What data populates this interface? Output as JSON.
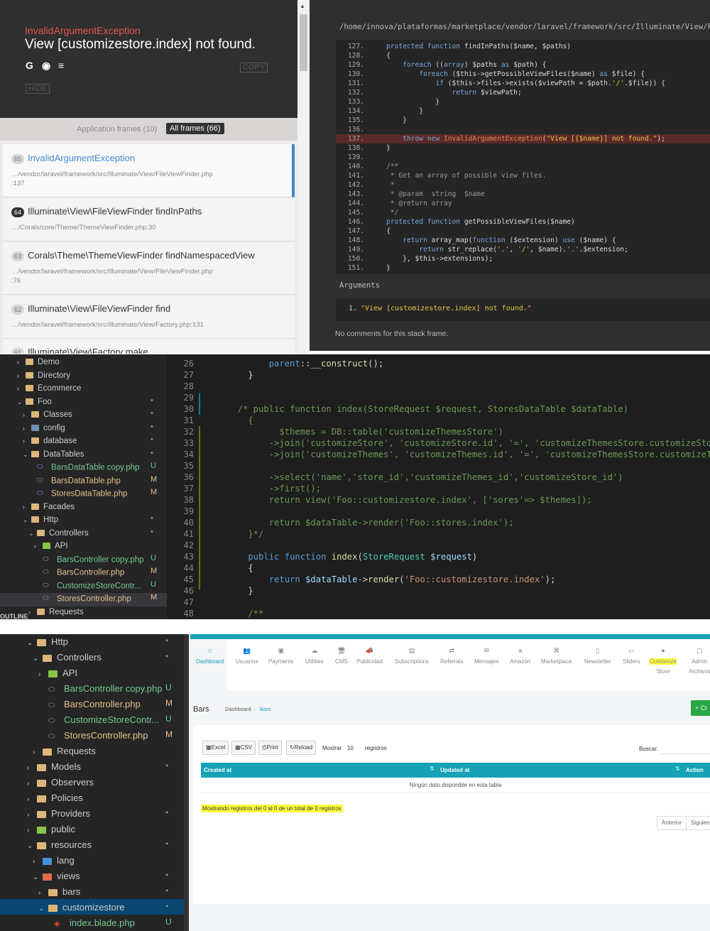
{
  "whoops": {
    "exception_class": "InvalidArgumentException",
    "exception_message": "View [customizestore.index] not found.",
    "copy_label": "COPY",
    "hide_label": "HIDE",
    "tabs": {
      "app": "Application frames (10)",
      "all": "All frames (66)"
    },
    "frames": [
      {
        "num": "65",
        "title": "InvalidArgumentException",
        "file": "…/vendor/laravel/framework/src/Illuminate/View/FileViewFinder.php",
        "line": ":137"
      },
      {
        "num": "64",
        "title": "Illuminate\\View\\FileViewFinder findInPaths",
        "file": "…/Corals/core/Theme/ThemeViewFinder.php:30",
        "line": ""
      },
      {
        "num": "63",
        "title": "Corals\\Theme\\ThemeViewFinder findNamespacedView",
        "file": "…/vendor/laravel/framework/src/Illuminate/View/FileViewFinder.php",
        "line": ":76"
      },
      {
        "num": "62",
        "title": "Illuminate\\View\\FileViewFinder find",
        "file": "…/vendor/laravel/framework/src/Illuminate/View/Factory.php:131",
        "line": ""
      },
      {
        "num": "61",
        "title": "Illuminate\\View\\Factory make",
        "file": "",
        "line": ""
      }
    ],
    "file_path": "/home/innova/plataformas/marketplace/vendor/laravel/framework/src/Illuminate/View/FileViewFinder.php",
    "arguments_title": "Arguments",
    "argument_num": "1.",
    "argument_1": "\"View [customizestore.index] not found.\"",
    "no_comments": "No comments for this stack frame.",
    "code": [
      {
        "n": "127.",
        "t": "    protected function findInPaths($name, $paths)"
      },
      {
        "n": "128.",
        "t": "    {"
      },
      {
        "n": "129.",
        "t": "        foreach ((array) $paths as $path) {"
      },
      {
        "n": "130.",
        "t": "            foreach ($this->getPossibleViewFiles($name) as $file) {"
      },
      {
        "n": "131.",
        "t": "                if ($this->files->exists($viewPath = $path.'/'.$file)) {"
      },
      {
        "n": "132.",
        "t": "                    return $viewPath;"
      },
      {
        "n": "133.",
        "t": "                }"
      },
      {
        "n": "134.",
        "t": "            }"
      },
      {
        "n": "135.",
        "t": "        }"
      },
      {
        "n": "136.",
        "t": ""
      },
      {
        "n": "137.",
        "t": "        throw new InvalidArgumentException(\"View [{$name}] not found.\");"
      },
      {
        "n": "138.",
        "t": "    }"
      },
      {
        "n": "139.",
        "t": ""
      },
      {
        "n": "140.",
        "t": "    /**"
      },
      {
        "n": "141.",
        "t": "     * Get an array of possible view files."
      },
      {
        "n": "142.",
        "t": "     *"
      },
      {
        "n": "143.",
        "t": "     * @param  string  $name"
      },
      {
        "n": "144.",
        "t": "     * @return array"
      },
      {
        "n": "145.",
        "t": "     */"
      },
      {
        "n": "146.",
        "t": "    protected function getPossibleViewFiles($name)"
      },
      {
        "n": "147.",
        "t": "    {"
      },
      {
        "n": "148.",
        "t": "        return array_map(function ($extension) use ($name) {"
      },
      {
        "n": "149.",
        "t": "            return str_replace('.', '/', $name).'.'.$extension;"
      },
      {
        "n": "150.",
        "t": "        }, $this->extensions);"
      },
      {
        "n": "151.",
        "t": "    }"
      }
    ]
  },
  "editor": {
    "tree": [
      {
        "label": "Demo",
        "indent": 0,
        "open": false,
        "kind": "folder",
        "badge": ""
      },
      {
        "label": "Directory",
        "indent": 0,
        "open": false,
        "kind": "folder",
        "badge": ""
      },
      {
        "label": "Ecommerce",
        "indent": 0,
        "open": false,
        "kind": "folder",
        "badge": ""
      },
      {
        "label": "Foo",
        "indent": 0,
        "open": true,
        "kind": "folder",
        "badge": "•"
      },
      {
        "label": "Classes",
        "indent": 1,
        "open": false,
        "kind": "folder",
        "badge": "•"
      },
      {
        "label": "config",
        "indent": 1,
        "open": false,
        "kind": "cfg",
        "badge": "•"
      },
      {
        "label": "database",
        "indent": 1,
        "open": false,
        "kind": "folder",
        "badge": "•"
      },
      {
        "label": "DataTables",
        "indent": 1,
        "open": true,
        "kind": "folder",
        "badge": "•"
      },
      {
        "label": "BarsDataTable copy.php",
        "indent": 2,
        "open": null,
        "kind": "php-u",
        "badge": "U"
      },
      {
        "label": "BarsDataTable.php",
        "indent": 2,
        "open": null,
        "kind": "php-m",
        "badge": "M"
      },
      {
        "label": "StoresDataTable.php",
        "indent": 2,
        "open": null,
        "kind": "php-m",
        "badge": "M"
      },
      {
        "label": "Facades",
        "indent": 1,
        "open": false,
        "kind": "folder",
        "badge": ""
      },
      {
        "label": "Http",
        "indent": 1,
        "open": true,
        "kind": "folder",
        "badge": "•"
      },
      {
        "label": "Controllers",
        "indent": 2,
        "open": true,
        "kind": "folder",
        "badge": "•"
      },
      {
        "label": "API",
        "indent": 3,
        "open": false,
        "kind": "api",
        "badge": ""
      },
      {
        "label": "BarsController copy.php",
        "indent": 3,
        "open": null,
        "kind": "php-u",
        "badge": "U"
      },
      {
        "label": "BarsController.php",
        "indent": 3,
        "open": null,
        "kind": "php-m",
        "badge": "M"
      },
      {
        "label": "CustomizeStoreContr...",
        "indent": 3,
        "open": null,
        "kind": "php-u",
        "badge": "U"
      },
      {
        "label": "StoresController.php",
        "indent": 3,
        "open": null,
        "kind": "php-m",
        "badge": "M"
      },
      {
        "label": "Requests",
        "indent": 2,
        "open": false,
        "kind": "folder",
        "badge": ""
      }
    ],
    "code": [
      {
        "n": "26",
        "t": "        parent::__construct();"
      },
      {
        "n": "27",
        "t": "    }"
      },
      {
        "n": "28",
        "t": ""
      },
      {
        "n": "29",
        "t": ""
      },
      {
        "n": "30",
        "t": "  /* public function index(StoreRequest $request, StoresDataTable $dataTable)"
      },
      {
        "n": "31",
        "t": "    {"
      },
      {
        "n": "32",
        "t": "          $themes = DB::table('customizeThemesStore')"
      },
      {
        "n": "33",
        "t": "        ->join('customizeStore', 'customizeStore.id', '=', 'customizeThemesStore.customizeSto"
      },
      {
        "n": "34",
        "t": "        ->join('customizeThemes', 'customizeThemes.id', '=', 'customizeThemesStore.customizeT"
      },
      {
        "n": "35",
        "t": ""
      },
      {
        "n": "36",
        "t": "        ->select('name','store_id','customizeThemes_id','customizeStore_id')"
      },
      {
        "n": "37",
        "t": "        ->first();"
      },
      {
        "n": "38",
        "t": "        return view('Foo::customizestore.index', ['sores'=> $themes]);"
      },
      {
        "n": "39",
        "t": ""
      },
      {
        "n": "40",
        "t": "        return $dataTable->render('Foo::stores.index');"
      },
      {
        "n": "41",
        "t": "    }*/"
      },
      {
        "n": "42",
        "t": ""
      },
      {
        "n": "43",
        "t": "    public function index(StoreRequest $request)"
      },
      {
        "n": "44",
        "t": "    {"
      },
      {
        "n": "45",
        "t": "        return $dataTable->render('Foo::customizestore.index');"
      },
      {
        "n": "46",
        "t": "    }"
      },
      {
        "n": "47",
        "t": ""
      },
      {
        "n": "48",
        "t": "    /**"
      }
    ],
    "outline_label": "OUTLINE"
  },
  "explorer2": {
    "tree": [
      {
        "label": "Http",
        "indent": 1,
        "open": true,
        "kind": "folder",
        "badge": "•"
      },
      {
        "label": "Controllers",
        "indent": 2,
        "open": true,
        "kind": "folder",
        "badge": "•"
      },
      {
        "label": "API",
        "indent": 3,
        "open": false,
        "kind": "api",
        "badge": ""
      },
      {
        "label": "BarsController copy.php",
        "indent": 3,
        "open": null,
        "kind": "php-u",
        "badge": "U"
      },
      {
        "label": "BarsController.php",
        "indent": 3,
        "open": null,
        "kind": "php-m",
        "badge": "M"
      },
      {
        "label": "CustomizeStoreContr...",
        "indent": 3,
        "open": null,
        "kind": "php-u",
        "badge": "U"
      },
      {
        "label": "StoresController.php",
        "indent": 3,
        "open": null,
        "kind": "php-m",
        "badge": "M"
      },
      {
        "label": "Requests",
        "indent": 2,
        "open": false,
        "kind": "folder",
        "badge": ""
      },
      {
        "label": "Models",
        "indent": 1,
        "open": false,
        "kind": "folder",
        "badge": "•"
      },
      {
        "label": "Observers",
        "indent": 1,
        "open": false,
        "kind": "folder",
        "badge": ""
      },
      {
        "label": "Policies",
        "indent": 1,
        "open": false,
        "kind": "folder",
        "badge": ""
      },
      {
        "label": "Providers",
        "indent": 1,
        "open": false,
        "kind": "folder",
        "badge": "•"
      },
      {
        "label": "public",
        "indent": 1,
        "open": false,
        "kind": "pub",
        "badge": ""
      },
      {
        "label": "resources",
        "indent": 1,
        "open": true,
        "kind": "folder",
        "badge": "•"
      },
      {
        "label": "lang",
        "indent": 2,
        "open": false,
        "kind": "lang",
        "badge": ""
      },
      {
        "label": "views",
        "indent": 2,
        "open": true,
        "kind": "views",
        "badge": "•"
      },
      {
        "label": "bars",
        "indent": 3,
        "open": false,
        "kind": "folder",
        "badge": "•"
      },
      {
        "label": "customizestore",
        "indent": 3,
        "open": true,
        "kind": "folder",
        "badge": "•"
      },
      {
        "label": "index.blade.php",
        "indent": 4,
        "open": null,
        "kind": "blade",
        "badge": "U"
      }
    ]
  },
  "app": {
    "nav": [
      {
        "label": "Dashboard",
        "icon": "⌂",
        "active": true
      },
      {
        "label": "Usuarios",
        "icon": "👥",
        "active": false
      },
      {
        "label": "Payments",
        "icon": "▣",
        "active": false
      },
      {
        "label": "Utilities",
        "icon": "☁",
        "active": false
      },
      {
        "label": "CMS",
        "icon": "🖥",
        "active": false
      },
      {
        "label": "Publicidad",
        "icon": "📣",
        "active": false
      },
      {
        "label": "Subscriptions",
        "icon": "▤",
        "active": false
      },
      {
        "label": "Referrals",
        "icon": "⇄",
        "active": false
      },
      {
        "label": "Mensajes",
        "icon": "✉",
        "active": false
      },
      {
        "label": "Amazon",
        "icon": "a",
        "active": false
      },
      {
        "label": "Marketplace",
        "icon": "⌘",
        "active": false
      },
      {
        "label": "Newsletter",
        "icon": "▯",
        "active": false
      },
      {
        "label": "Sliders",
        "icon": "▭",
        "active": false
      },
      {
        "label": "Customize",
        "label2": "Store",
        "icon": "●",
        "active": false,
        "highlight": true
      },
      {
        "label": "Admin",
        "label2": "Archivos",
        "icon": "▢",
        "active": false
      }
    ],
    "page_title": "Bars",
    "breadcrumb": [
      "Dashboard",
      "Bars"
    ],
    "create_label": "+ Cr",
    "buttons": [
      "Excel",
      "CSV",
      "Print",
      "Reload"
    ],
    "mostrar": "Mostrar",
    "length": "10",
    "registros": "registros",
    "buscar": "Buscar:",
    "columns": [
      "Created at",
      "Updated at",
      "Action"
    ],
    "empty": "Ningún dato disponible en esta tabla",
    "info": "Mostrando registros del 0 al 0 de un total de 0 registros",
    "pager": [
      "Anterior",
      "Siguiente"
    ],
    "colors": {
      "accent": "#17a2b8",
      "success": "#28a745",
      "highlight": "#ffff3b"
    }
  }
}
